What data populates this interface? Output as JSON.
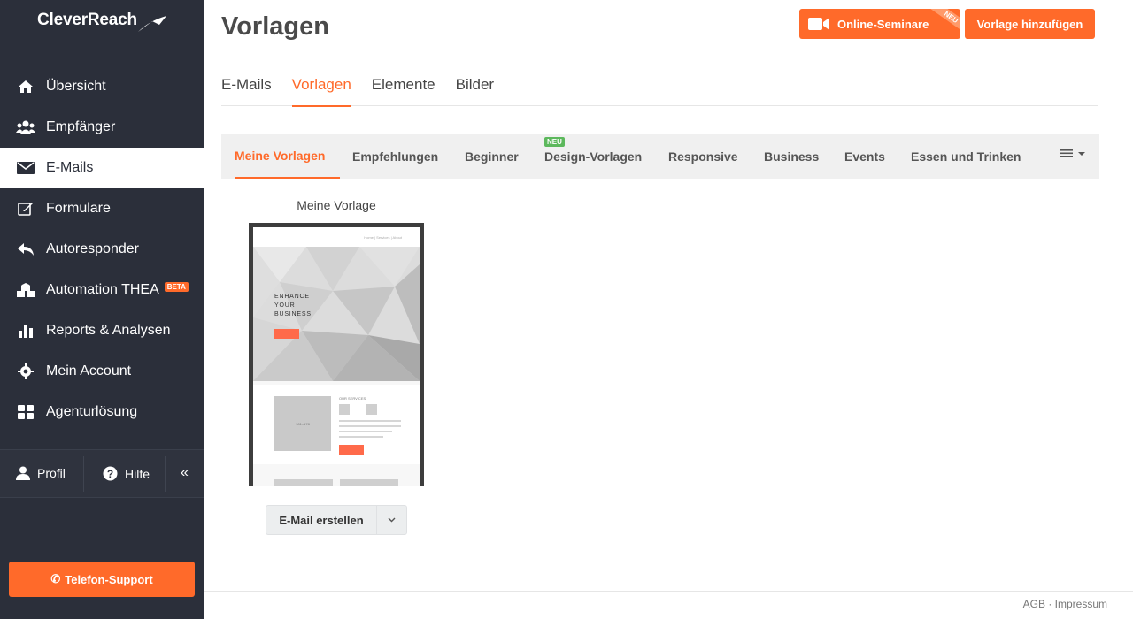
{
  "app": {
    "logo_text": "CleverReach"
  },
  "sidebar": {
    "items": [
      {
        "label": "Übersicht",
        "icon": "home-icon"
      },
      {
        "label": "Empfänger",
        "icon": "users-icon"
      },
      {
        "label": "E-Mails",
        "icon": "envelope-icon",
        "active": true
      },
      {
        "label": "Formulare",
        "icon": "edit-icon"
      },
      {
        "label": "Autoresponder",
        "icon": "reply-icon"
      },
      {
        "label": "Automation THEA",
        "icon": "cubes-icon",
        "badge": "BETA"
      },
      {
        "label": "Reports & Analysen",
        "icon": "bar-chart-icon"
      },
      {
        "label": "Mein Account",
        "icon": "gear-icon"
      },
      {
        "label": "Agenturlösung",
        "icon": "grid-icon"
      }
    ],
    "profile_label": "Profil",
    "help_label": "Hilfe",
    "collapse_glyph": "«",
    "phone_support_label": "Telefon-Support"
  },
  "header": {
    "title": "Vorlagen",
    "seminar_button": "Online-Seminare",
    "seminar_ribbon": "NEU",
    "add_template_button": "Vorlage hinzufügen"
  },
  "tabs": [
    {
      "label": "E-Mails"
    },
    {
      "label": "Vorlagen",
      "active": true
    },
    {
      "label": "Elemente"
    },
    {
      "label": "Bilder"
    }
  ],
  "subtabs": [
    {
      "label": "Meine Vorlagen",
      "active": true
    },
    {
      "label": "Empfehlungen"
    },
    {
      "label": "Beginner"
    },
    {
      "label": "Design-Vorlagen",
      "badge": "NEU"
    },
    {
      "label": "Responsive"
    },
    {
      "label": "Business"
    },
    {
      "label": "Events"
    },
    {
      "label": "Essen und Trinken"
    }
  ],
  "template_card": {
    "title": "Meine Vorlage",
    "preview": {
      "nav_text": "Home | Services | About",
      "hero_text": "ENHANCE\nYOUR\nBUSINESS",
      "services_title": "OUR SERVICES",
      "image_label": "181×178"
    },
    "create_button": "E-Mail erstellen"
  },
  "footer": {
    "agb": "AGB",
    "separator": "·",
    "impressum": "Impressum"
  },
  "colors": {
    "accent": "#ff6a2a",
    "sidebar_bg": "#2b2f3a",
    "new_badge": "#5cb85c"
  }
}
